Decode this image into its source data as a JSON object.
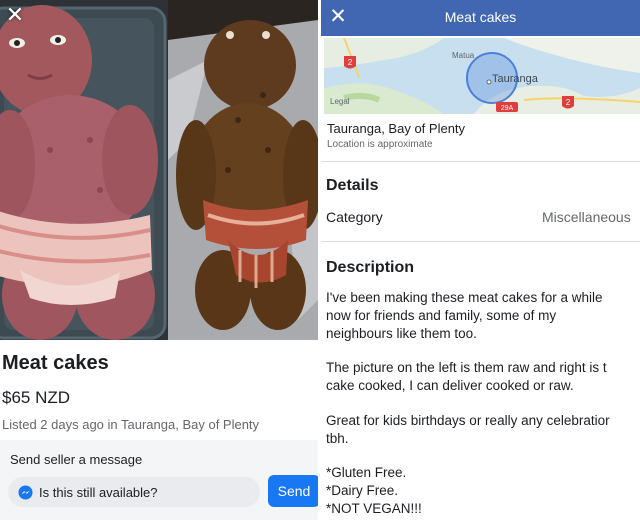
{
  "left_screen": {
    "close_symbol": "✕",
    "listing": {
      "title": "Meat cakes",
      "price": "$65 NZD",
      "meta": "Listed 2 days ago in Tauranga, Bay of Plenty"
    },
    "message": {
      "heading": "Send seller a message",
      "input_value": "Is this still available?",
      "send_label": "Send"
    }
  },
  "right_screen": {
    "close_symbol": "✕",
    "title": "Meat cakes",
    "map": {
      "labels": [
        "Matua",
        "Tauranga",
        "Legal",
        "2",
        "2",
        "29A"
      ]
    },
    "location": {
      "name": "Tauranga, Bay of Plenty",
      "note": "Location is approximate"
    },
    "details": {
      "heading": "Details",
      "category_label": "Category",
      "category_value": "Miscellaneous"
    },
    "description": {
      "heading": "Description",
      "lines": [
        "I've been making these meat cakes for a while",
        "now for friends and family, some of my",
        "neighbours like them too.",
        "The picture on the left is them raw and right is t",
        "cake cooked, I can deliver cooked or raw.",
        "Great for kids birthdays or really any celebratior",
        "tbh.",
        "*Gluten Free.",
        "*Dairy Free.",
        "*NOT VEGAN!!!"
      ]
    }
  },
  "colors": {
    "facebook_blue": "#4267b2",
    "send_blue": "#1877f2",
    "raw_meat": "#a3585e",
    "cooked_meat": "#5e3a1f",
    "bacon": "#e8b4ad"
  }
}
